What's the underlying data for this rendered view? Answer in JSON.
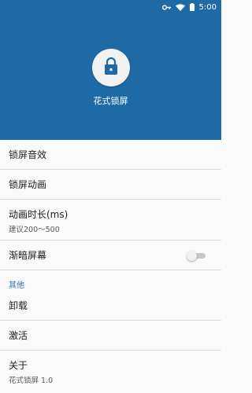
{
  "status_bar": {
    "time": "5:00",
    "icons": [
      "key-icon",
      "wifi-icon",
      "battery-icon"
    ]
  },
  "header": {
    "app_title": "花式锁屏",
    "icon": "lock-icon",
    "background": "#1e6aa7"
  },
  "settings": {
    "lock_sound": {
      "title": "锁屏音效"
    },
    "lock_animation": {
      "title": "锁屏动画"
    },
    "animation_duration": {
      "title": "动画时长(ms)",
      "summary": "建议200～500"
    },
    "dim_screen": {
      "title": "渐暗屏幕",
      "enabled": false
    },
    "other_section": {
      "title": "其他"
    },
    "uninstall": {
      "title": "卸载"
    },
    "activate": {
      "title": "激活"
    },
    "about": {
      "title": "关于",
      "summary": "花式锁屏 1.0"
    }
  },
  "colors": {
    "accent": "#2b6fb3",
    "divider": "#dedede"
  }
}
